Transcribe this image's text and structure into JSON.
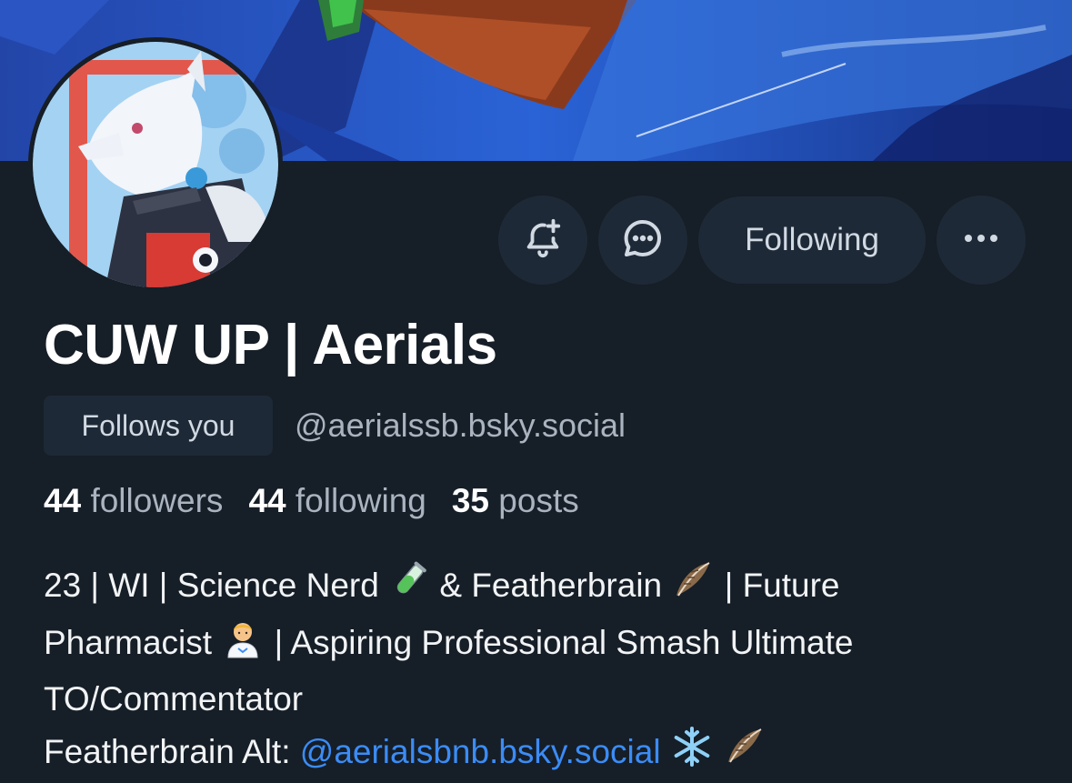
{
  "profile": {
    "display_name": "CUW UP | Aerials",
    "follows_you_label": "Follows you",
    "handle": "@aerialssb.bsky.social"
  },
  "actions": {
    "following_label": "Following",
    "more_label": "•••"
  },
  "stats": {
    "followers_count": "44",
    "followers_label": "followers",
    "following_count": "44",
    "following_label": "following",
    "posts_count": "35",
    "posts_label": "posts"
  },
  "bio": {
    "line1_a": "23 | WI | Science Nerd",
    "line1_b": "& Featherbrain",
    "line1_c": "| Future",
    "line2_a": "Pharmacist",
    "line2_b": "| Aspiring Professional Smash Ultimate",
    "line3": "TO/Commentator",
    "line4_prefix": "Featherbrain Alt:",
    "line4_mention": "@aerialsbnb.bsky.social"
  },
  "icons": {
    "bell": "bell-plus-icon",
    "message": "chat-bubble-icon",
    "more": "ellipsis-icon",
    "test_tube": "test-tube-emoji",
    "feather": "feather-emoji",
    "pharmacist": "health-worker-emoji",
    "snowflake": "snowflake-emoji"
  },
  "colors": {
    "background": "#161e27",
    "button_bg": "#1e2937",
    "muted_text": "#aab4c0",
    "link": "#3b8cf6"
  }
}
